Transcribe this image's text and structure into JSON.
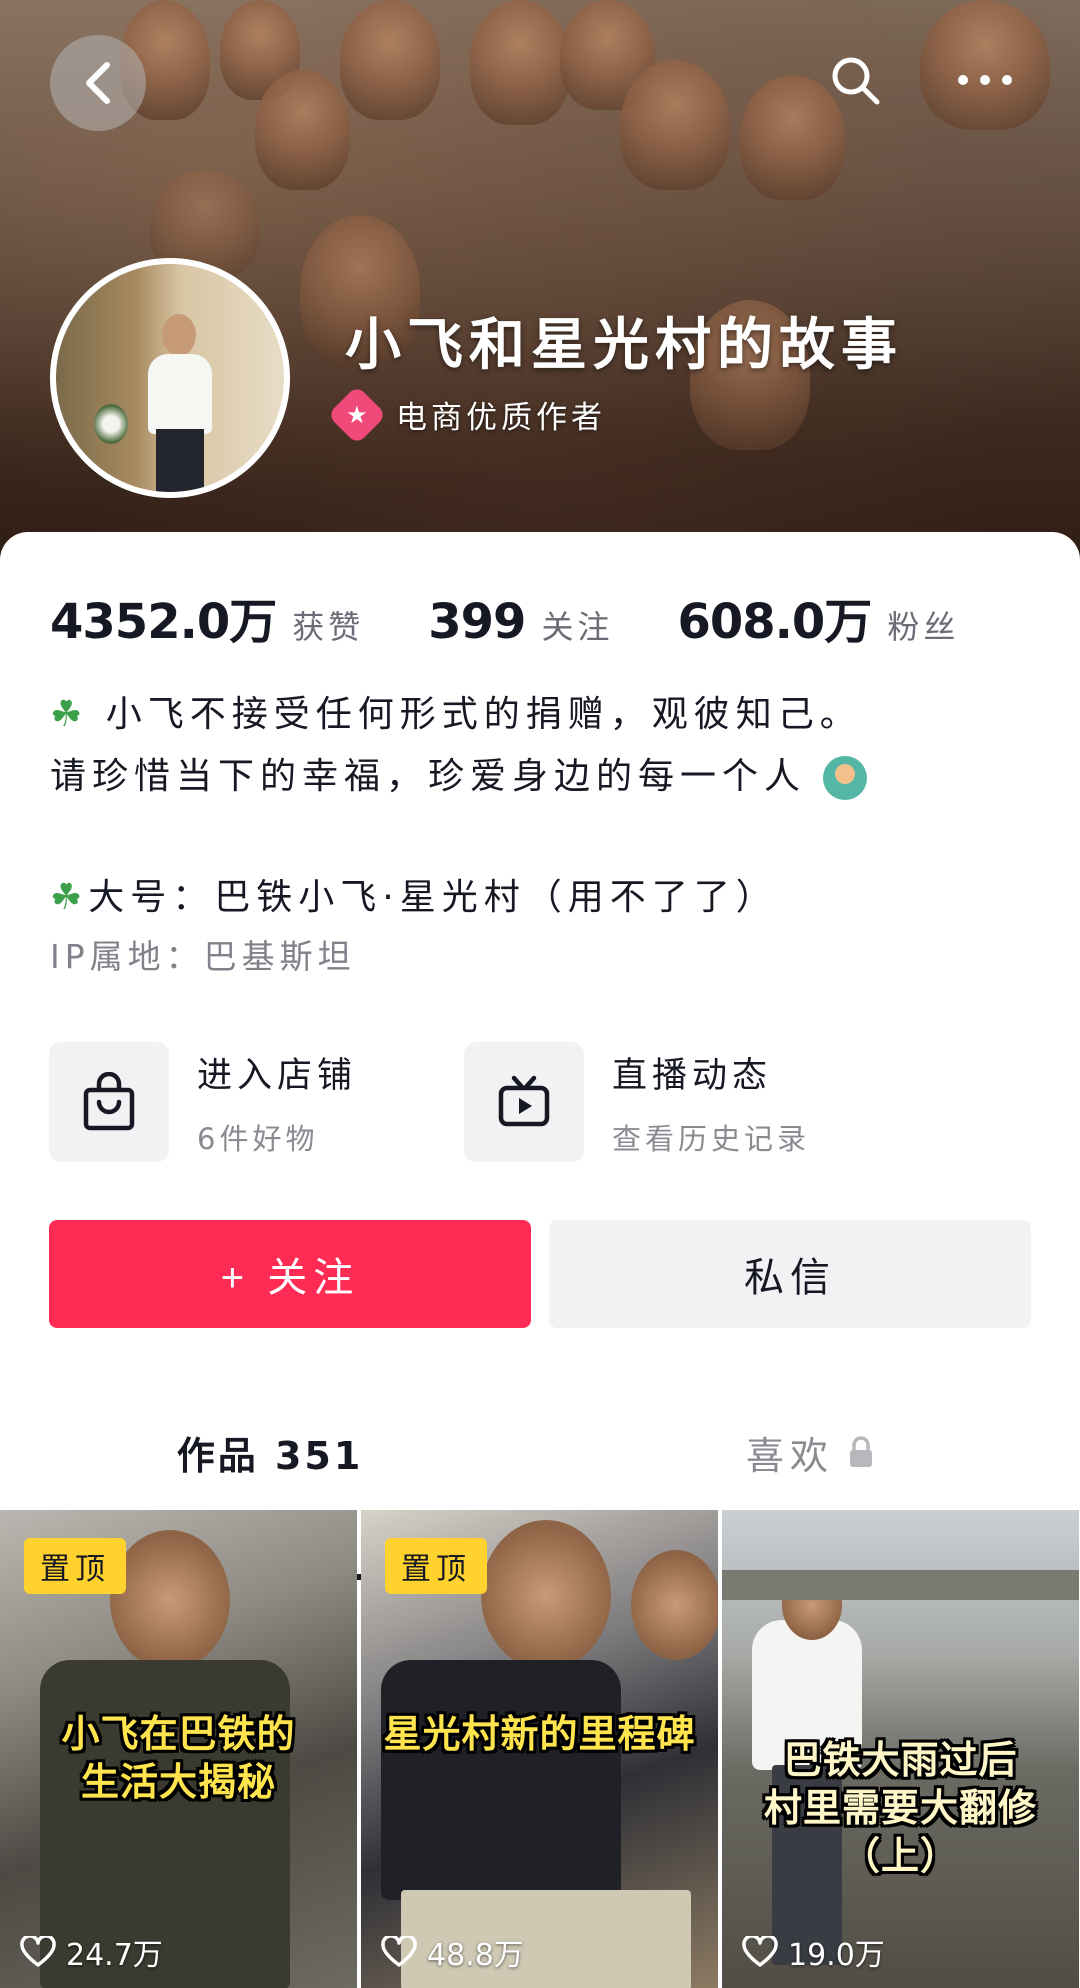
{
  "header": {
    "back_icon": "chevron-left-icon",
    "search_icon": "search-icon",
    "more_icon": "more-horizontal-icon"
  },
  "profile": {
    "nickname": "小飞和星光村的故事",
    "badge_text": "电商优质作者",
    "badge_icon": "star-badge-icon"
  },
  "stats": [
    {
      "value": "4352.0万",
      "label": "获赞"
    },
    {
      "value": "399",
      "label": "关注"
    },
    {
      "value": "608.0万",
      "label": "粉丝"
    }
  ],
  "bio": {
    "line1": "小飞不接受任何形式的捐赠，观彼知己。",
    "line2": "请珍惜当下的幸福，珍爱身边的每一个人",
    "alt_account": "大号：巴铁小飞·星光村（用不了了）",
    "ip_location": "IP属地：巴基斯坦"
  },
  "entries": {
    "shop": {
      "title": "进入店铺",
      "subtitle": "6件好物",
      "icon": "shopping-bag-icon"
    },
    "live": {
      "title": "直播动态",
      "subtitle": "查看历史记录",
      "icon": "tv-icon"
    }
  },
  "actions": {
    "follow": "+ 关注",
    "message": "私信"
  },
  "tabs": {
    "works": "作品 351",
    "likes": "喜欢",
    "likes_icon": "lock-icon"
  },
  "videos": [
    {
      "pinned": "置顶",
      "caption_line1": "小飞在巴铁的",
      "caption_line2": "生活大揭秘",
      "caption_line3": "",
      "likes": "24.7万"
    },
    {
      "pinned": "置顶",
      "caption_line1": "星光村新的里程碑",
      "caption_line2": "",
      "caption_line3": "",
      "likes": "48.8万"
    },
    {
      "pinned": "",
      "caption_line1": "巴铁大雨过后",
      "caption_line2": "村里需要大翻修",
      "caption_line3": "（上）",
      "likes": "19.0万"
    }
  ],
  "colors": {
    "accent": "#fe2c55",
    "pin_tag": "#ffd22e",
    "leaf": "#3ca04a"
  }
}
